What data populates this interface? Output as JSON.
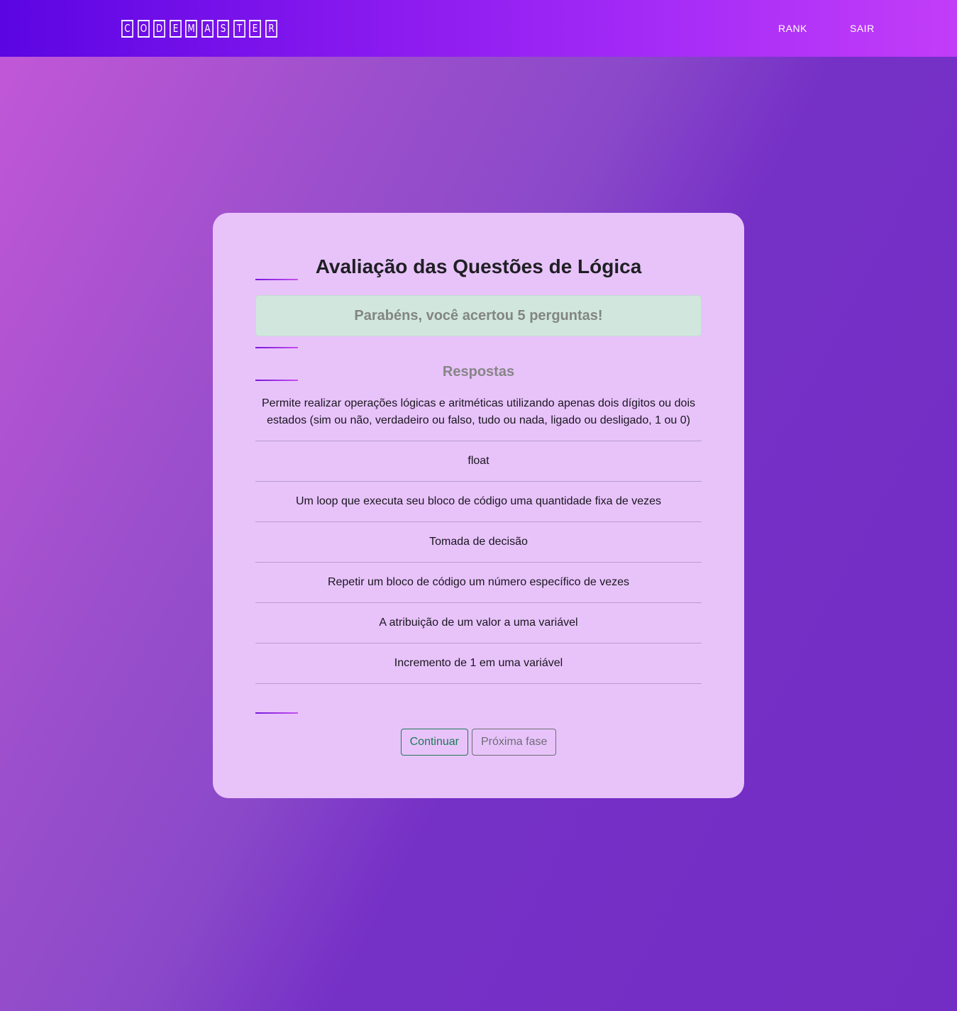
{
  "header": {
    "logo_letters": [
      "C",
      "O",
      "D",
      "E",
      "M",
      "A",
      "S",
      "T",
      "E",
      "R"
    ],
    "nav": {
      "rank_label": "RANK",
      "exit_label": "SAIR"
    }
  },
  "card": {
    "title": "Avaliação das Questões de Lógica",
    "result_message": "Parabéns, você acertou 5 perguntas!",
    "answers_heading": "Respostas",
    "answers": [
      "Permite realizar operações lógicas e aritméticas utilizando apenas dois dígitos ou dois estados (sim ou não, verdadeiro ou falso, tudo ou nada, ligado ou desligado, 1 ou 0)",
      "float",
      "Um loop que executa seu bloco de código uma quantidade fixa de vezes",
      "Tomada de decisão",
      "Repetir um bloco de código um número específico de vezes",
      "A atribuição de um valor a uma variável",
      "Incremento de 1 em uma variável"
    ],
    "buttons": {
      "continue_label": "Continuar",
      "next_phase_label": "Próxima fase"
    }
  },
  "colors": {
    "header_gradient_start": "#5b05e3",
    "header_gradient_end": "#c23df8",
    "card_background": "#e8c3fa",
    "alert_background": "#d1e7dd",
    "continue_button": "#1c7a54",
    "next_button": "#6e6d76"
  }
}
